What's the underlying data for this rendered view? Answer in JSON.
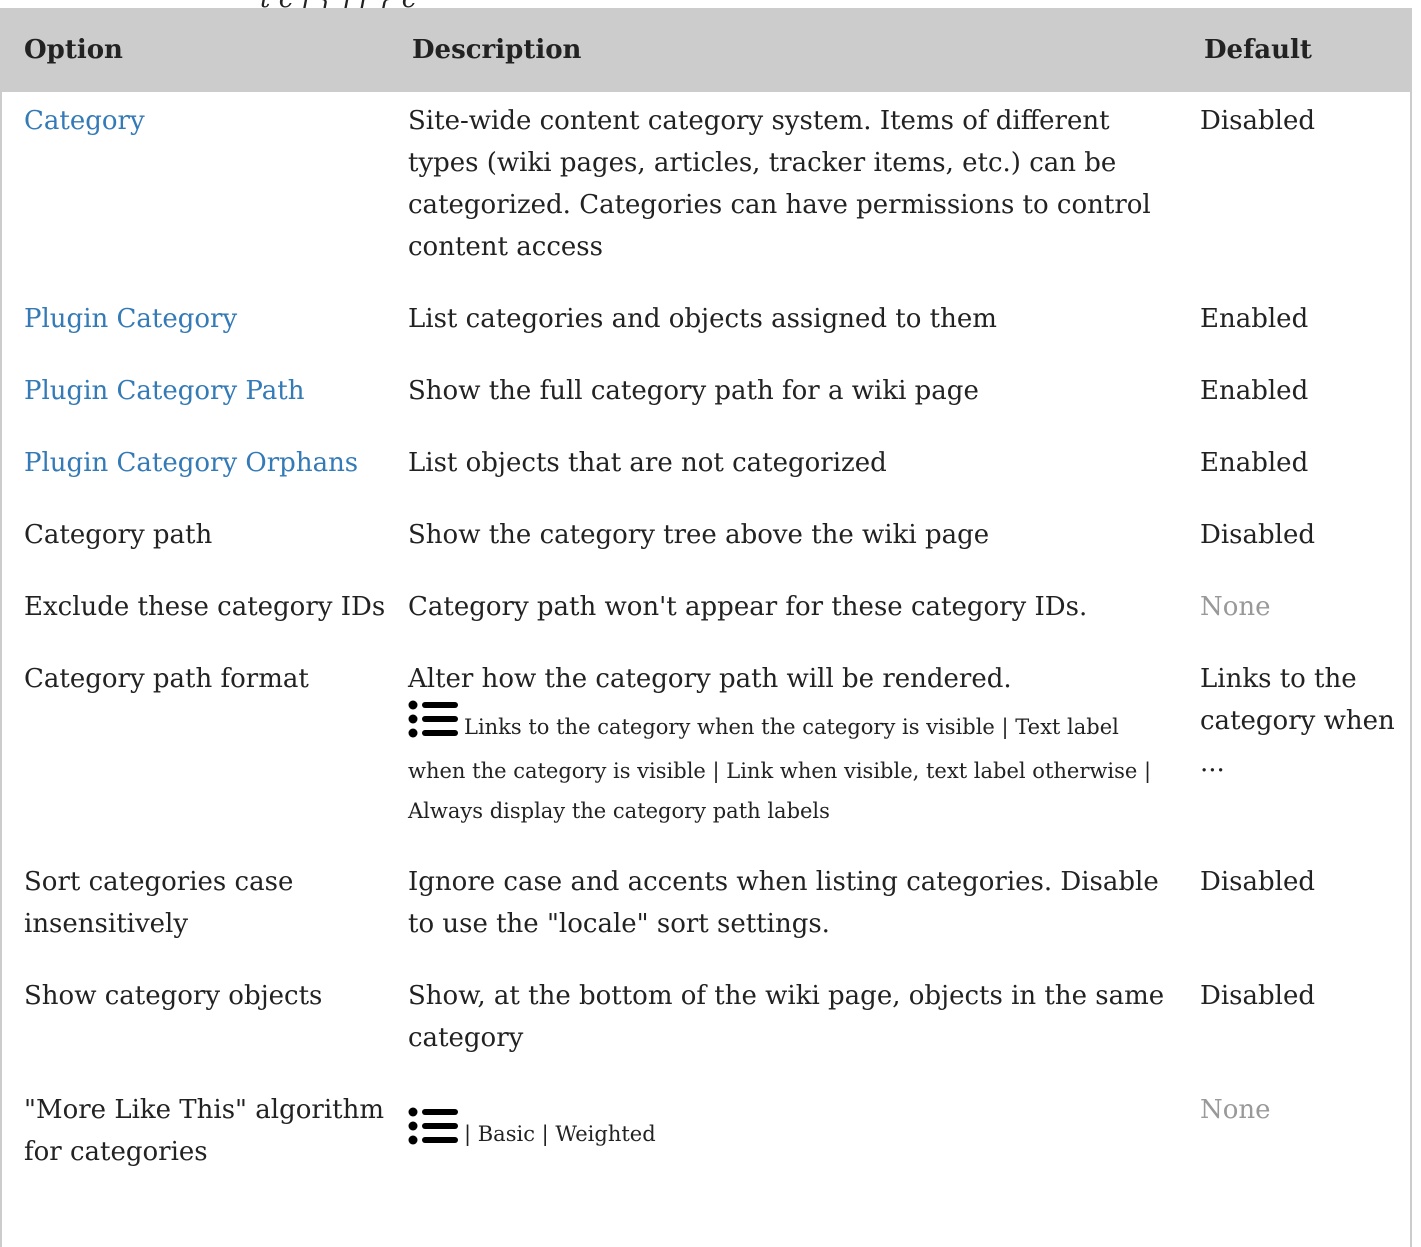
{
  "top_fragment": "t c j { j f } c",
  "table": {
    "headers": {
      "option": "Option",
      "description": "Description",
      "default": "Default"
    },
    "rows": [
      {
        "option": "Category",
        "option_is_link": true,
        "description": "Site-wide content category system. Items of different types (wiki pages, articles, tracker items, etc.) can be categorized. Categories can have permissions to control content access",
        "default": "Disabled"
      },
      {
        "option": "Plugin Category",
        "option_is_link": true,
        "description": "List categories and objects assigned to them",
        "default": "Enabled"
      },
      {
        "option": "Plugin Category Path",
        "option_is_link": true,
        "description": "Show the full category path for a wiki page",
        "default": "Enabled"
      },
      {
        "option": "Plugin Category Orphans",
        "option_is_link": true,
        "description": "List objects that are not categorized",
        "default": "Enabled"
      },
      {
        "option": "Category path",
        "option_is_link": false,
        "description": "Show the category tree above the wiki page",
        "default": "Disabled"
      },
      {
        "option": "Exclude these category IDs",
        "option_is_link": false,
        "description": "Category path won't appear for these category IDs.",
        "default": "None",
        "default_muted": true
      },
      {
        "option": "Category path format",
        "option_is_link": false,
        "description": "Alter how the category path will be rendered.",
        "list_icon": "list-icon",
        "options_text": "Links to the category when the category is visible | Text label when the category is visible | Link when visible, text label otherwise | Always display the category path labels",
        "default": "Links to the category when ..."
      },
      {
        "option": "Sort categories case insensitively",
        "option_is_link": false,
        "description": "Ignore case and accents when listing categories. Disable to use the \"locale\" sort settings.",
        "default": "Disabled"
      },
      {
        "option": "Show category objects",
        "option_is_link": false,
        "description": "Show, at the bottom of the wiki page, objects in the same category",
        "default": "Disabled"
      },
      {
        "option": "\"More Like This\" algorithm for categories",
        "option_is_link": false,
        "list_icon": "list-icon",
        "options_text": "| Basic | Weighted",
        "default": "None",
        "default_muted": true
      }
    ]
  },
  "colors": {
    "header_bg": "#cccccc",
    "link": "#337ab7",
    "muted": "#999999",
    "text": "#222222"
  }
}
